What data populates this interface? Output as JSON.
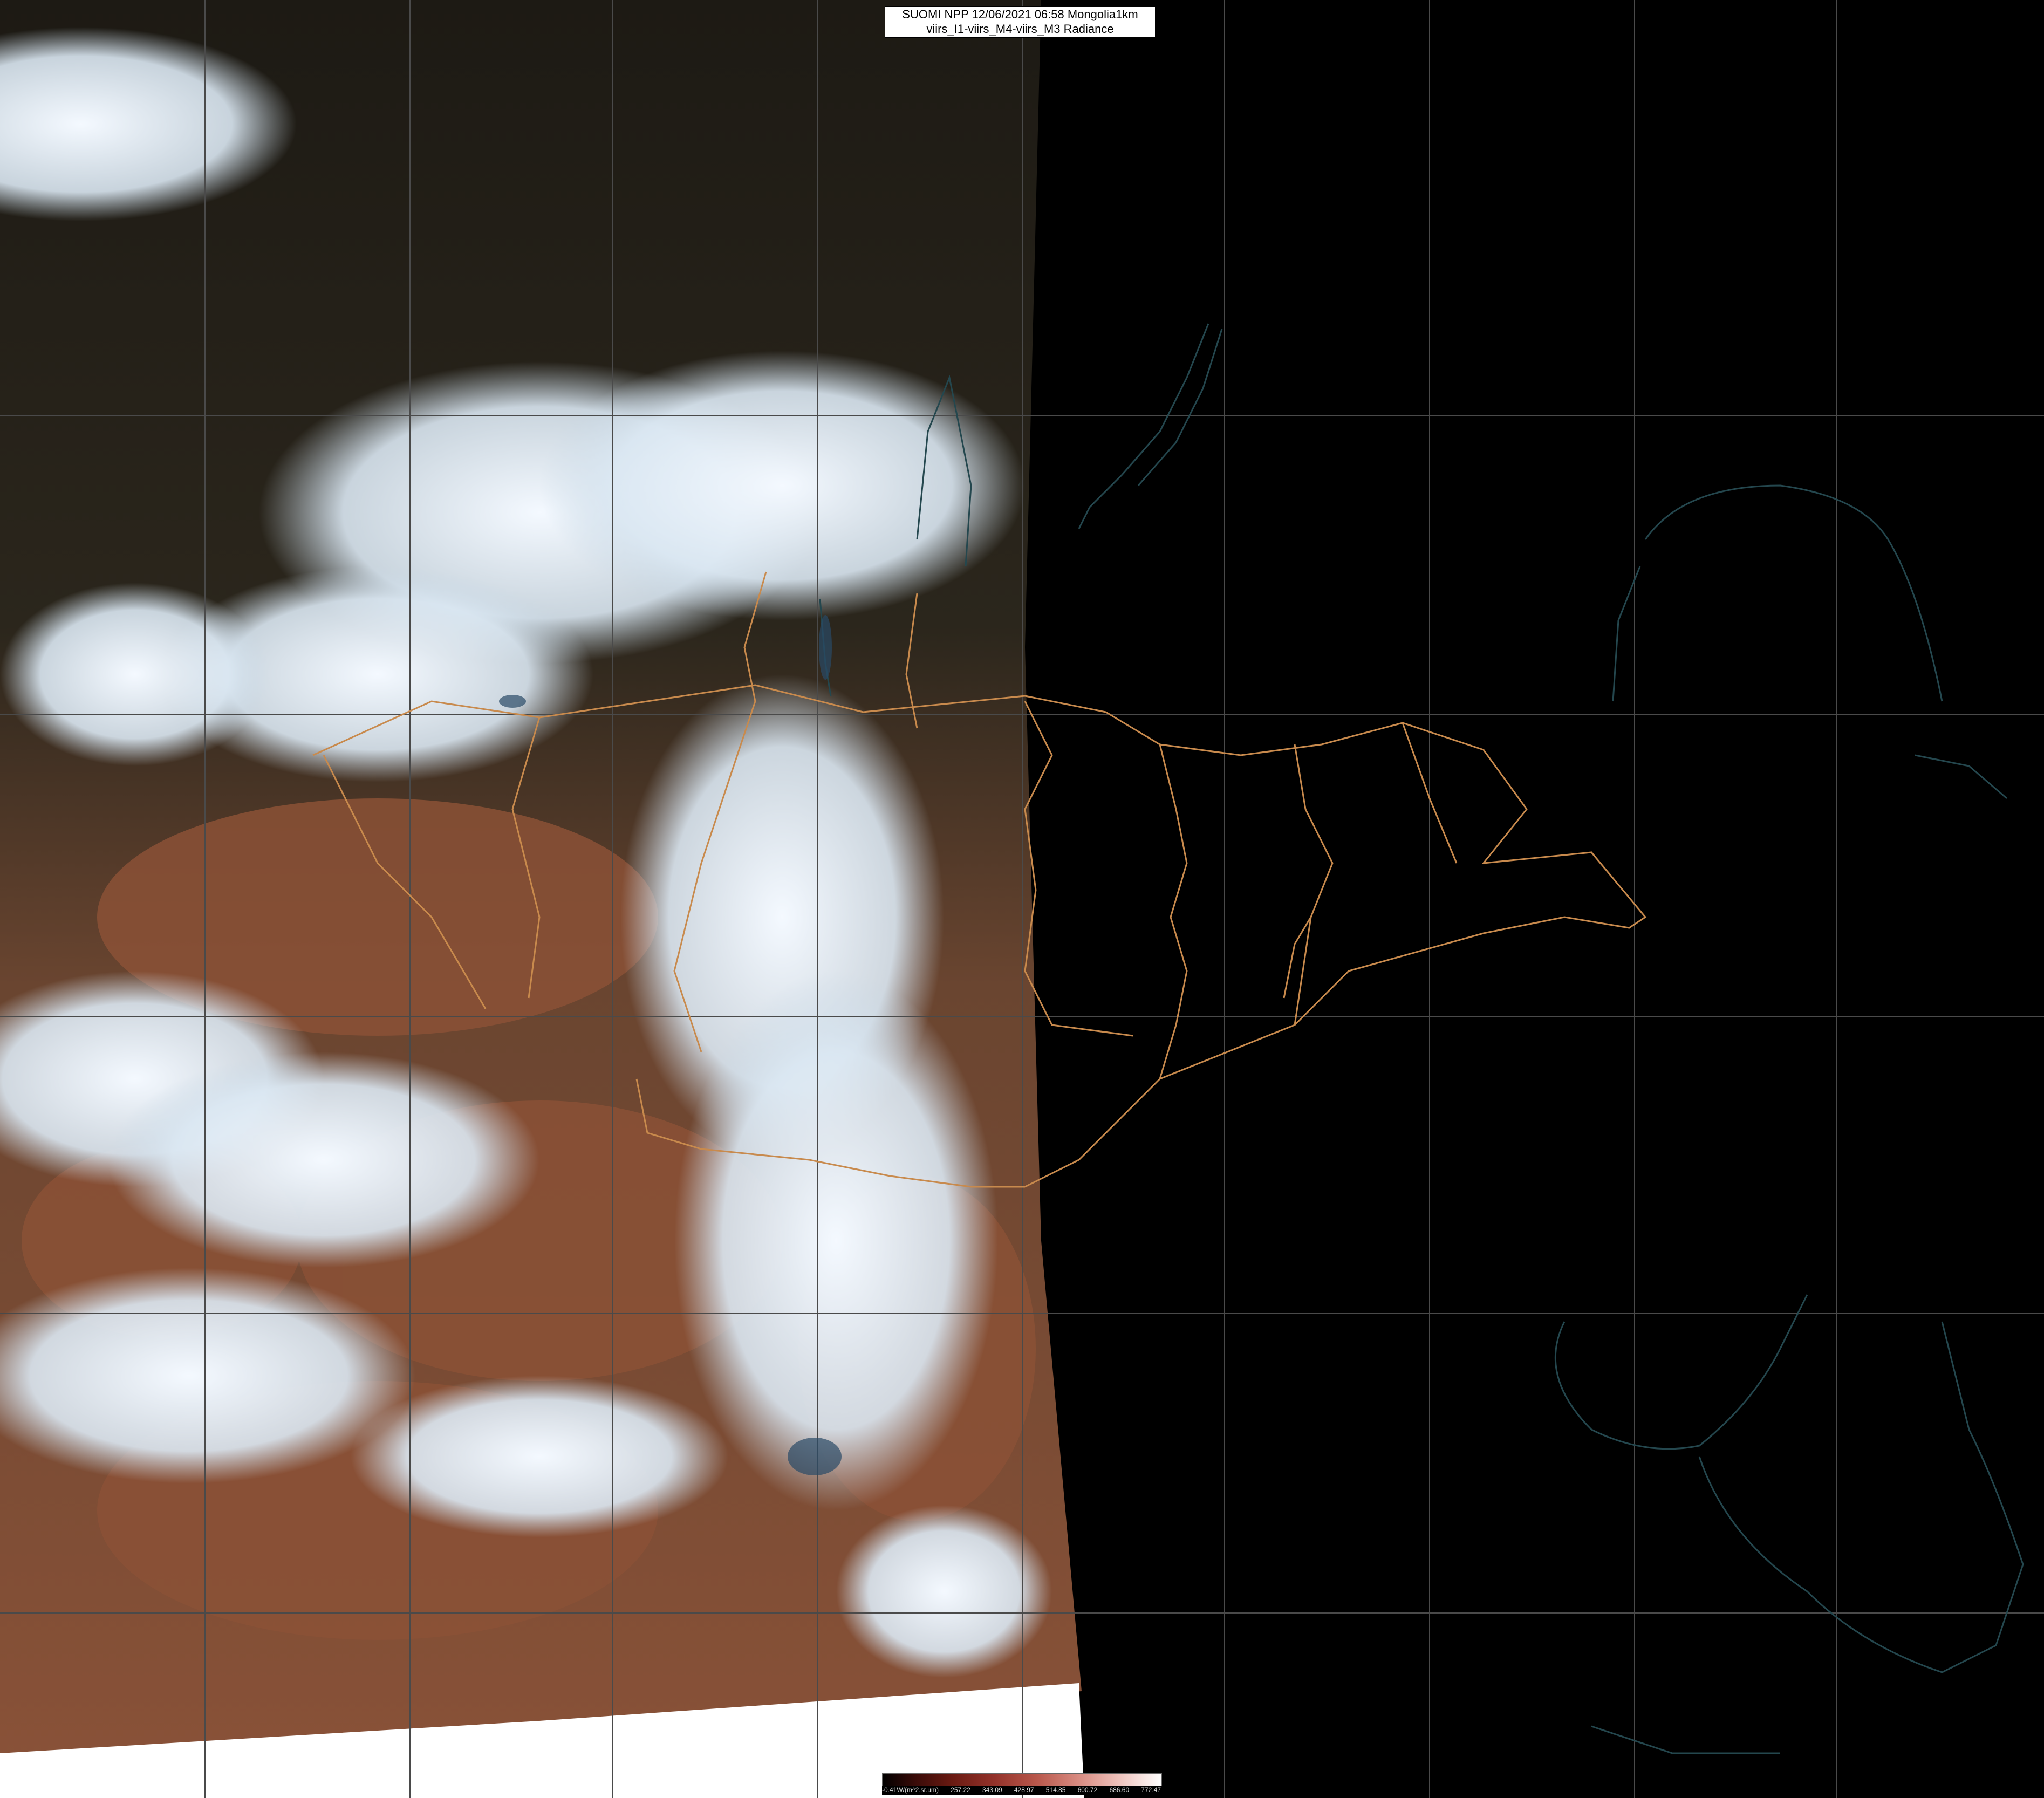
{
  "title": {
    "line1": "SUOMI NPP 12/06/2021 06:58 Mongolia1km",
    "line2": "viirs_I1-viirs_M4-viirs_M3 Radiance"
  },
  "legend": {
    "unit_label": "-0.41W/(m^2.sr.um)",
    "ticks": [
      "257.22",
      "343.09",
      "428.97",
      "514.85",
      "600.72",
      "686.60",
      "772.47"
    ]
  },
  "colors": {
    "space": "#000000",
    "cloud": "#e6f0f8",
    "land": "#7a4a32",
    "border": "#d49a4e",
    "coast": "#23444a",
    "grid": "#505050"
  }
}
